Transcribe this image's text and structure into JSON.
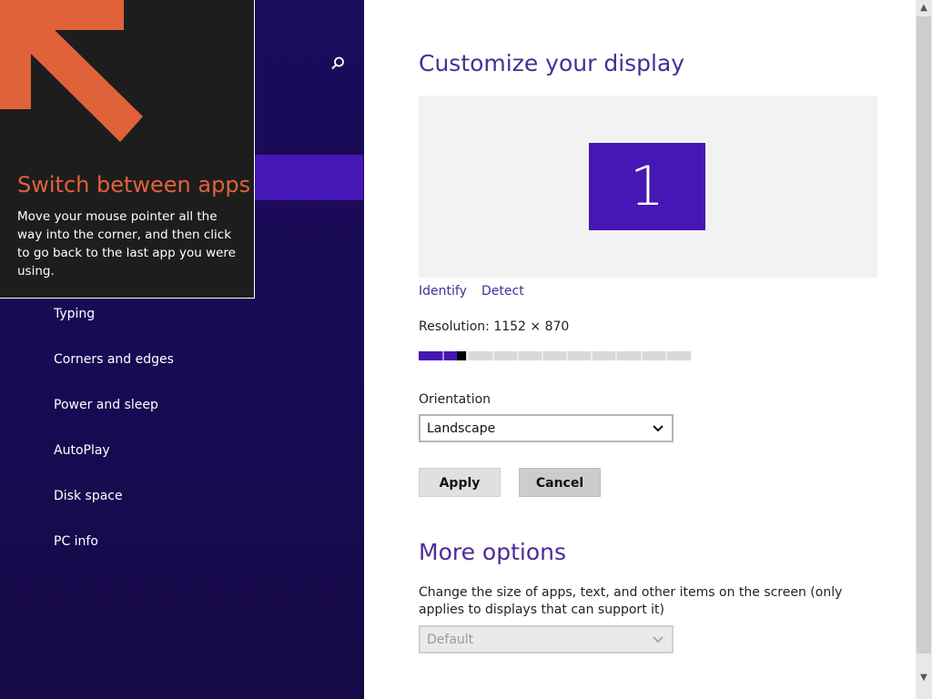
{
  "nav": {
    "items": [
      {
        "label": "Typing"
      },
      {
        "label": "Corners and edges"
      },
      {
        "label": "Power and sleep"
      },
      {
        "label": "AutoPlay"
      },
      {
        "label": "Disk space"
      },
      {
        "label": "PC info"
      }
    ],
    "search_icon": "search-icon"
  },
  "tip": {
    "title": "Switch between apps",
    "body": "Move your mouse pointer all the way into the corner, and then click to go back to the last app you were using.",
    "arrow_color": "#e0623a"
  },
  "display": {
    "title": "Customize your display",
    "monitor_number": "1",
    "identify_label": "Identify",
    "detect_label": "Detect",
    "resolution_label": "Resolution: 1152 × 870",
    "resolution_slider_fraction": 0.14,
    "orientation_label": "Orientation",
    "orientation_value": "Landscape",
    "apply_label": "Apply",
    "cancel_label": "Cancel"
  },
  "more_options": {
    "title": "More options",
    "description": "Change the size of apps, text, and other items on the screen (only applies to displays that can support it)",
    "size_value": "Default"
  },
  "colors": {
    "accent": "#4617b4",
    "nav_background": "#180a52",
    "heading": "#4a2d96",
    "tip_title": "#e0623a"
  }
}
